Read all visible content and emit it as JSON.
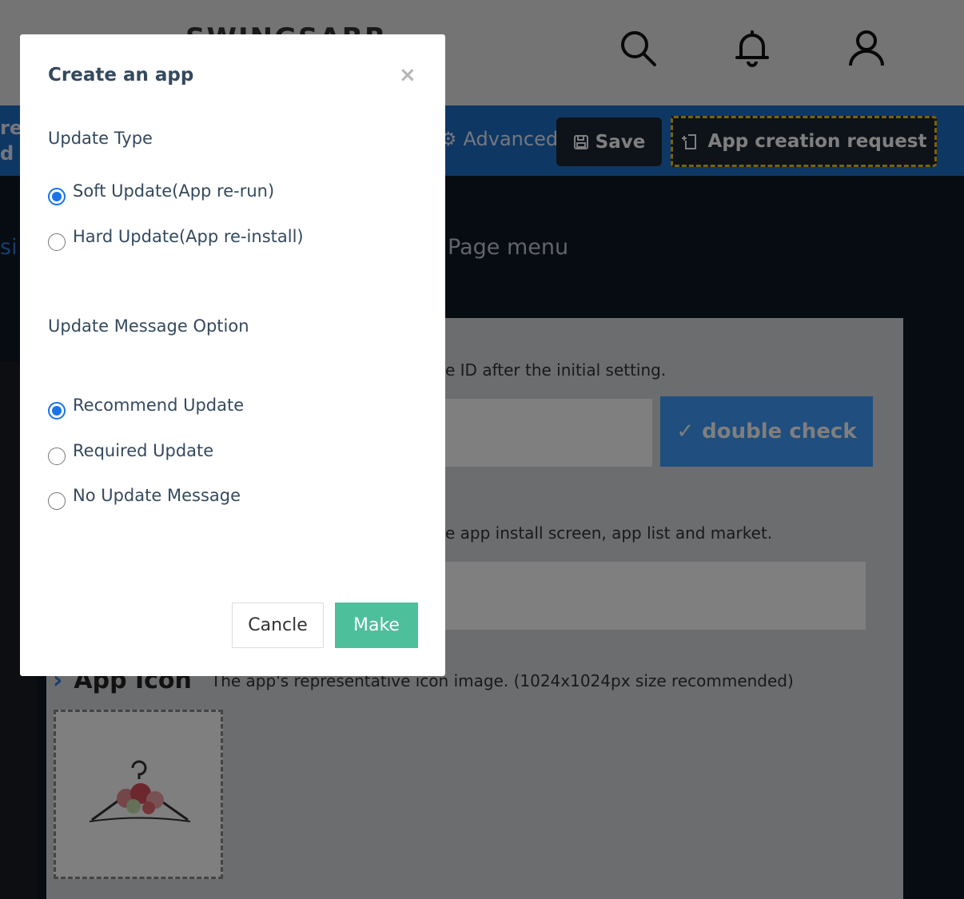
{
  "header": {
    "logo_text": "SWINGSARR",
    "icons": [
      "search-icon",
      "bell-icon",
      "user-icon"
    ]
  },
  "toolbar": {
    "left_peek_1": "re",
    "left_peek_2": "d",
    "advanced_label": "Advanced",
    "save_label": "Save",
    "request_label": "App creation request"
  },
  "main": {
    "side_peek": "si",
    "page_menu": "Page menu",
    "id_hint": "e ID after the initial setting.",
    "double_check_label": "double check",
    "name_hint": "e app install screen, app list and market.",
    "app_icon_label": "App Icon",
    "app_icon_hint": "The app's representative icon image. (1024x1024px size recommended)"
  },
  "modal": {
    "title": "Create an app",
    "close": "×",
    "update_type": {
      "label": "Update Type",
      "options": [
        {
          "label": "Soft Update(App re-run)",
          "selected": true
        },
        {
          "label": "Hard Update(App re-install)",
          "selected": false
        }
      ]
    },
    "message_option": {
      "label": "Update Message Option",
      "options": [
        {
          "label": "Recommend Update",
          "selected": true
        },
        {
          "label": "Required Update",
          "selected": false
        },
        {
          "label": "No Update Message",
          "selected": false
        }
      ]
    },
    "cancel_label": "Cancle",
    "make_label": "Make"
  },
  "colors": {
    "brand_blue": "#1c6fc8",
    "make_green": "#4dbf9b",
    "highlight_yellow": "#f5c21b",
    "radio_blue": "#1a73e8"
  }
}
